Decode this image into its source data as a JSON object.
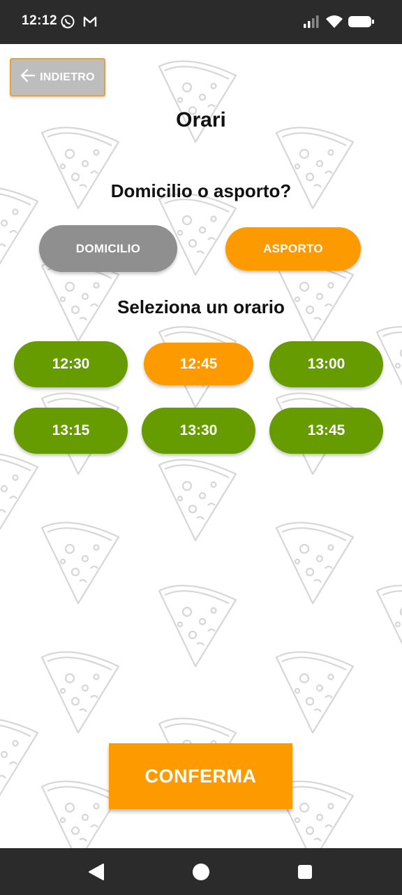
{
  "status_bar": {
    "time": "12:12",
    "icons": [
      "whatsapp-icon",
      "gmail-icon",
      "signal-icon",
      "wifi-icon",
      "battery-icon"
    ]
  },
  "toolbar": {
    "back_label": "INDIETRO",
    "back_icon": "arrow-left-icon"
  },
  "page": {
    "title": "Orari",
    "delivery_question": "Domicilio o asporto?",
    "time_question": "Seleziona un orario"
  },
  "delivery_options": [
    {
      "label": "DOMICILIO",
      "state": "unselected"
    },
    {
      "label": "ASPORTO",
      "state": "selected"
    }
  ],
  "time_slots": [
    {
      "label": "12:30",
      "selected": false
    },
    {
      "label": "12:45",
      "selected": true
    },
    {
      "label": "13:00",
      "selected": false
    },
    {
      "label": "13:15",
      "selected": false
    },
    {
      "label": "13:30",
      "selected": false
    },
    {
      "label": "13:45",
      "selected": false
    }
  ],
  "footer": {
    "confirm_label": "CONFERMA"
  },
  "colors": {
    "accent_orange": "#fd9a00",
    "slot_green": "#669c00",
    "inactive_grey": "#8f8f8f",
    "system_bar": "#2b2b2b"
  },
  "nav_bar": {
    "icons": [
      "back-triangle-icon",
      "home-circle-icon",
      "recents-square-icon"
    ]
  }
}
